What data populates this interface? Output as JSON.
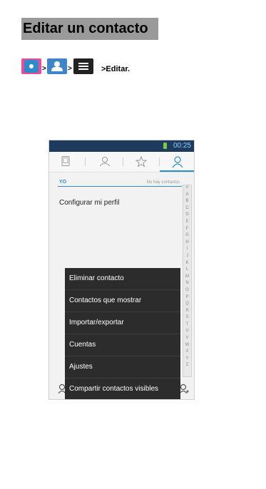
{
  "heading": "Editar un contacto",
  "steps": {
    "sep1": ">",
    "sep2": ">",
    "label": ">Editar."
  },
  "colors": {
    "app_icon_pink": "#e94c9b",
    "app_icon_blue": "#2e8bc9",
    "contacts_icon_blue": "#3f86c9",
    "menu_icon_dark": "#222222",
    "title_bg": "#9a9a9a",
    "accent": "#2e8bc9"
  },
  "screenshot": {
    "status_time": "00:25",
    "tabs": [
      "phone-icon",
      "groups-icon",
      "star-icon",
      "person-icon"
    ],
    "section_label": "YO",
    "no_contacts": "No hay contactos",
    "profile_text": "Configurar mi perfil",
    "index_letters": [
      "#",
      "A",
      "B",
      "C",
      "D",
      "E",
      "F",
      "G",
      "H",
      "I",
      "J",
      "K",
      "L",
      "M",
      "N",
      "O",
      "P",
      "Q",
      "R",
      "S",
      "T",
      "U",
      "V",
      "W",
      "X",
      "Y",
      "Z"
    ],
    "menu": [
      "Eliminar contacto",
      "Contactos que mostrar",
      "Importar/exportar",
      "Cuentas",
      "Ajustes",
      "Compartir contactos visibles"
    ]
  }
}
